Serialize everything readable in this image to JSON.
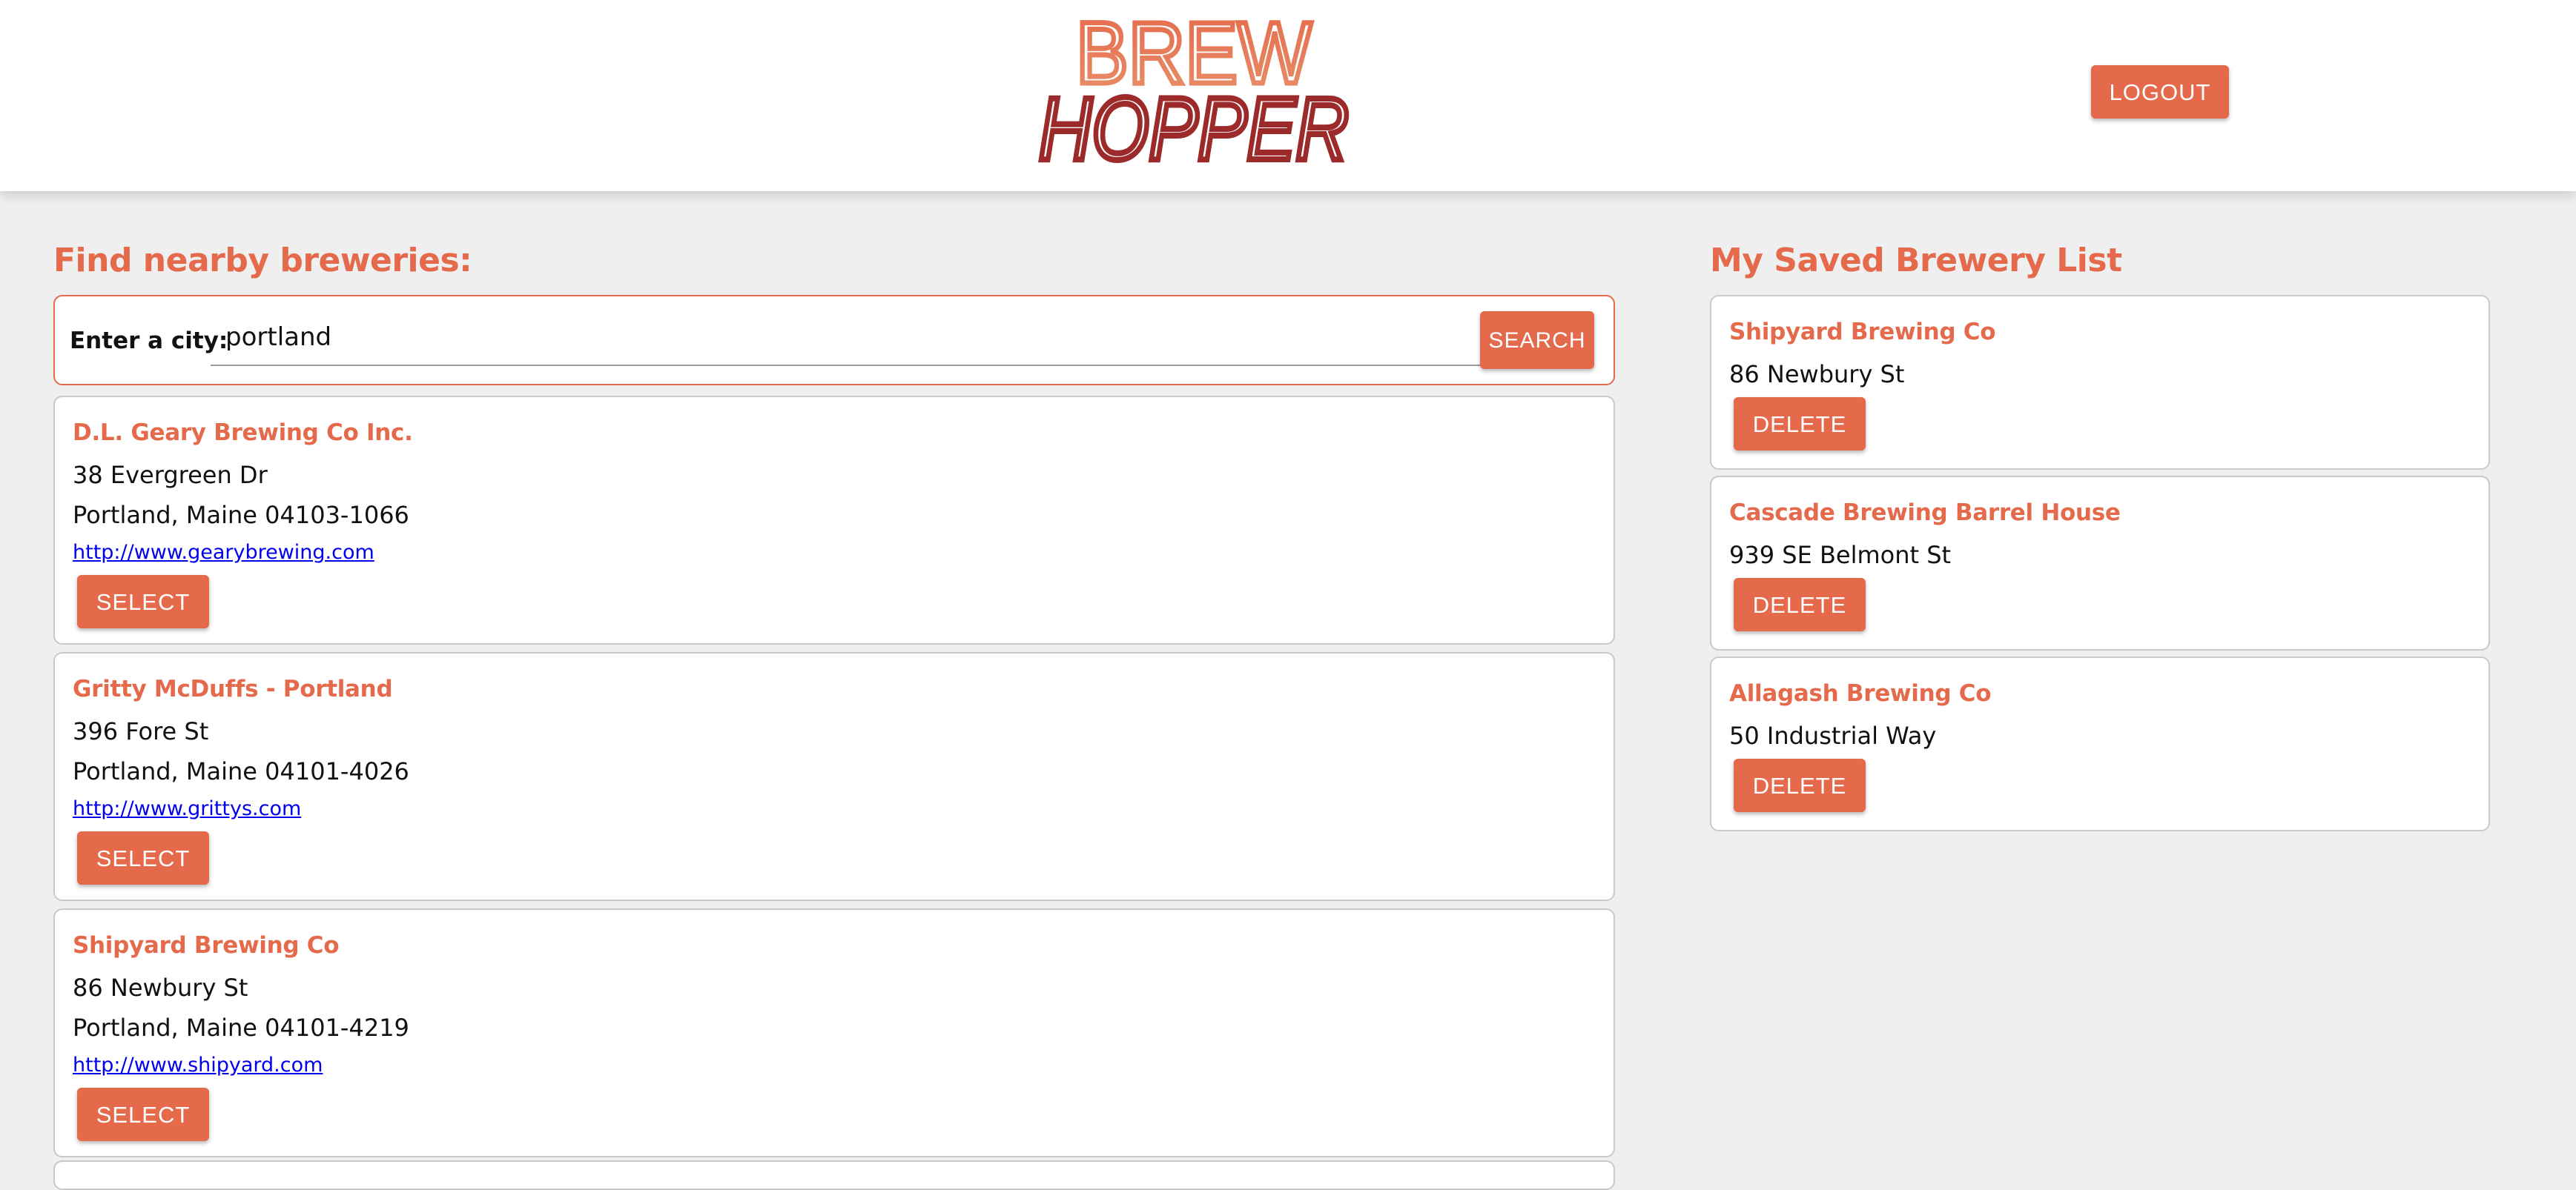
{
  "header": {
    "logo_top": "BREW",
    "logo_bottom": "HOPPER",
    "logout_label": "LOGOUT"
  },
  "search": {
    "heading": "Find nearby breweries:",
    "label": "Enter a city:",
    "value": "portland",
    "button_label": "SEARCH"
  },
  "results": [
    {
      "name": "D.L. Geary Brewing Co Inc.",
      "street": "38 Evergreen Dr",
      "city_line": "Portland, Maine 04103-1066",
      "url": "http://www.gearybrewing.com",
      "button_label": "SELECT"
    },
    {
      "name": "Gritty McDuffs - Portland",
      "street": "396 Fore St",
      "city_line": "Portland, Maine 04101-4026",
      "url": "http://www.grittys.com",
      "button_label": "SELECT"
    },
    {
      "name": "Shipyard Brewing Co",
      "street": "86 Newbury St",
      "city_line": "Portland, Maine 04101-4219",
      "url": "http://www.shipyard.com",
      "button_label": "SELECT"
    }
  ],
  "saved": {
    "heading": "My Saved Brewery List",
    "items": [
      {
        "name": "Shipyard Brewing Co",
        "street": "86 Newbury St",
        "button_label": "DELETE"
      },
      {
        "name": "Cascade Brewing Barrel House",
        "street": "939 SE Belmont St",
        "button_label": "DELETE"
      },
      {
        "name": "Allagash Brewing Co",
        "street": "50 Industrial Way",
        "button_label": "DELETE"
      }
    ]
  },
  "colors": {
    "accent": "#e5694b",
    "logo_dark": "#9c2a2a",
    "link": "#0000ee",
    "background": "#efefef"
  }
}
